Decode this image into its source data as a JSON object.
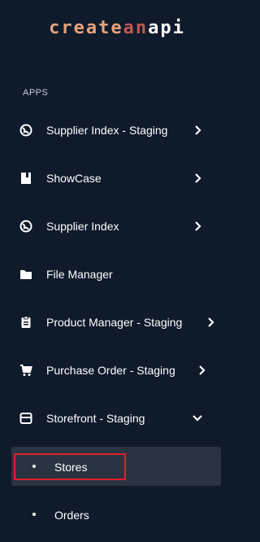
{
  "logo": {
    "part1": "create",
    "part2": "an",
    "part3": "api"
  },
  "section": {
    "label": "APPS"
  },
  "nav": {
    "items": [
      {
        "label": "Supplier Index - Staging",
        "icon": "globe-icon",
        "chevron": "right"
      },
      {
        "label": "ShowCase",
        "icon": "book-icon",
        "chevron": "right"
      },
      {
        "label": "Supplier Index",
        "icon": "globe-icon",
        "chevron": "right"
      },
      {
        "label": "File Manager",
        "icon": "folder-icon",
        "chevron": ""
      },
      {
        "label": "Product Manager - Staging",
        "icon": "clipboard-icon",
        "chevron": "right"
      },
      {
        "label": "Purchase Order - Staging",
        "icon": "cart-icon",
        "chevron": "right"
      },
      {
        "label": "Storefront - Staging",
        "icon": "storefront-icon",
        "chevron": "down"
      }
    ],
    "subitems": [
      {
        "label": "Stores",
        "active": true
      },
      {
        "label": "Orders",
        "active": false
      }
    ]
  },
  "colors": {
    "background": "#0f1a2b",
    "active_bg": "#2a3342",
    "highlight": "#e0202a"
  }
}
